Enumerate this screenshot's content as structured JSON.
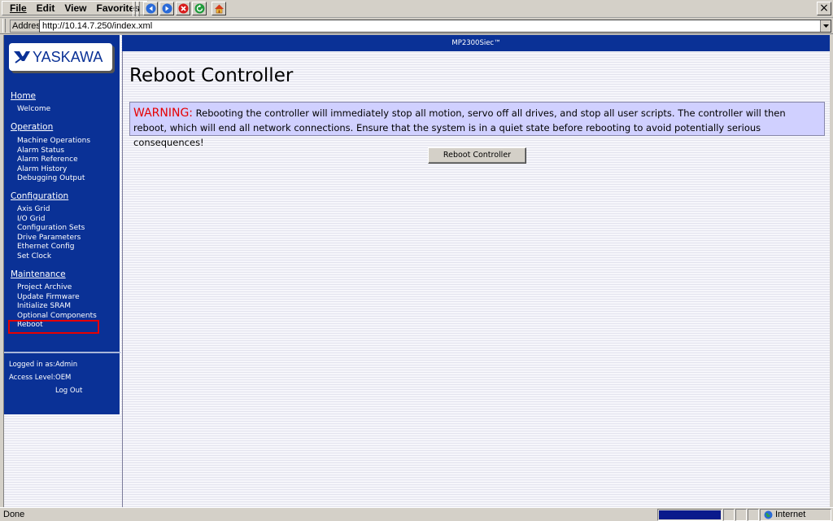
{
  "menu": {
    "file": "File",
    "edit": "Edit",
    "view": "View",
    "favorites": "Favorites"
  },
  "address": {
    "label": "Address",
    "url": "http://10.14.7.250/index.xml"
  },
  "logo_text": "YASKAWA",
  "header_title": "MP2300Siec™",
  "sidebar": {
    "sections": [
      {
        "title": "Home",
        "items": [
          "Welcome"
        ]
      },
      {
        "title": "Operation",
        "items": [
          "Machine Operations",
          "Alarm Status",
          "Alarm Reference",
          "Alarm History",
          "Debugging Output"
        ]
      },
      {
        "title": "Configuration",
        "items": [
          "Axis Grid",
          "I/O Grid",
          "Configuration Sets",
          "Drive Parameters",
          "Ethernet Config",
          "Set Clock"
        ]
      },
      {
        "title": "Maintenance",
        "items": [
          "Project Archive",
          "Update Firmware",
          "Initialize SRAM",
          "Optional Components",
          "Reboot"
        ]
      }
    ],
    "logged_in_label": "Logged in as:",
    "logged_in_value": "Admin",
    "access_level_label": "Access Level:",
    "access_level_value": "OEM",
    "logout": "Log Out"
  },
  "main": {
    "title": "Reboot Controller",
    "warning_label": "WARNING:",
    "warning_text": " Rebooting the controller will immediately stop all motion, servo off all drives, and stop all user scripts. The controller will then reboot, which will end all network connections. Ensure that the system is in a quiet state before rebooting to avoid potentially serious consequences!",
    "reboot_button": "Reboot Controller"
  },
  "status": {
    "text": "Done",
    "zone": "Internet",
    "progress_percent": 100
  },
  "colors": {
    "brand_blue": "#0a3196",
    "warning_red": "#e60000",
    "warning_bg": "#d0d0ff"
  }
}
